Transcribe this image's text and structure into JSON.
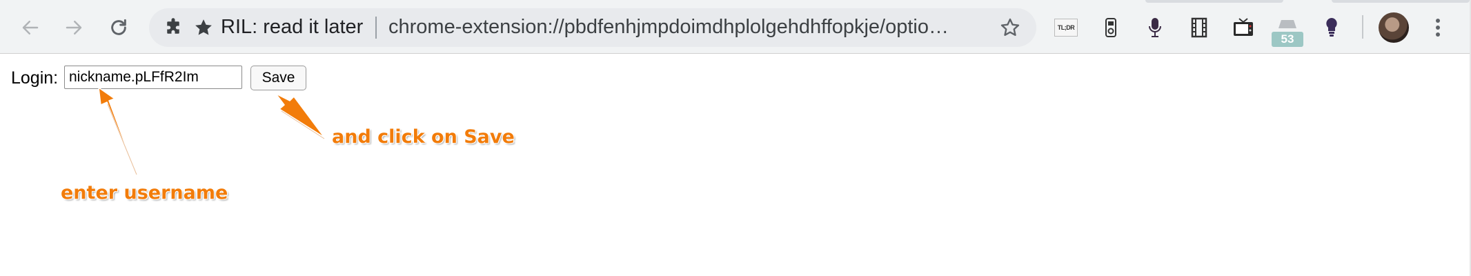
{
  "browser": {
    "tab_title": "RIL: read it later",
    "url": "chrome-extension://pbdfenhjmpdoimdhplolgehdhffopkje/optio…",
    "extensions": [
      {
        "name": "tldr-extension-icon",
        "label": "TL;DR"
      },
      {
        "name": "ipod-icon"
      },
      {
        "name": "microphone-icon"
      },
      {
        "name": "film-strip-icon"
      },
      {
        "name": "tv-icon"
      },
      {
        "name": "cloud-badge-icon",
        "badge": "53"
      },
      {
        "name": "lightbulb-icon"
      }
    ],
    "colors": {
      "toolbar": "#f1f3f4",
      "omnibox": "#e8eaed",
      "badge": "#9cc7c4"
    }
  },
  "page": {
    "login_label": "Login:",
    "login_value": "nickname.pLFfR2Im",
    "save_label": "Save"
  },
  "annotations": {
    "save_hint": "and click on Save",
    "username_hint": "enter username",
    "color": "#f27c0a"
  }
}
